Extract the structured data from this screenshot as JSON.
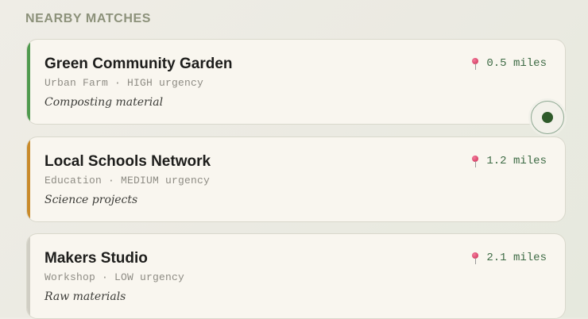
{
  "section": {
    "title": "NEARBY MATCHES"
  },
  "matches": [
    {
      "name": "Green Community Garden",
      "category": "Urban Farm",
      "urgency": "HIGH",
      "meta": "Urban Farm · HIGH urgency",
      "need": "Composting material",
      "distance": "0.5 miles",
      "stripe_color": "#4f9a4e",
      "icon": "pin-icon"
    },
    {
      "name": "Local Schools Network",
      "category": "Education",
      "urgency": "MEDIUM",
      "meta": "Education · MEDIUM urgency",
      "need": "Science projects",
      "distance": "1.2 miles",
      "stripe_color": "#c98a2a",
      "icon": "pin-icon"
    },
    {
      "name": "Makers Studio",
      "category": "Workshop",
      "urgency": "LOW",
      "meta": "Workshop · LOW urgency",
      "need": "Raw materials",
      "distance": "2.1 miles",
      "stripe_color": "#d0cec4",
      "icon": "pin-icon"
    }
  ],
  "selected_match_index": 0,
  "colors": {
    "accent": "#2e5a2a",
    "distance_text": "#3e6b45",
    "section_title": "#8c917a"
  }
}
